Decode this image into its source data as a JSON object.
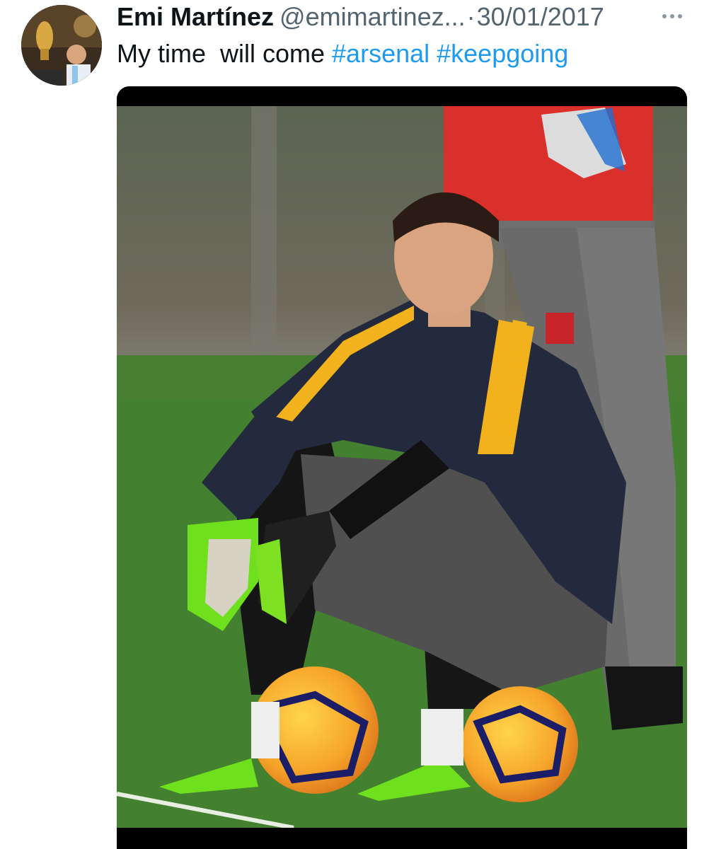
{
  "tweet": {
    "author": {
      "display_name": "Emi Martínez",
      "handle": "@emimartinez...",
      "avatar_icon": "profile-photo-holding-trophy"
    },
    "separator": "·",
    "date": "30/01/2017",
    "more_icon": "more-horizontal-icon",
    "text": {
      "body": "My time  will come ",
      "hashtags": [
        "#arsenal",
        "#keepgoing"
      ]
    },
    "media": {
      "kind": "photo",
      "subject": "goalkeeper sitting on footballs on training pitch"
    }
  },
  "colors": {
    "link": "#1d9bf0",
    "text": "#0f1419",
    "muted": "#536471",
    "pitch_green": "#3f7a2c",
    "jacket_navy": "#232a3d",
    "jacket_yellow": "#f2b21d",
    "boots_green": "#6fe01d"
  }
}
